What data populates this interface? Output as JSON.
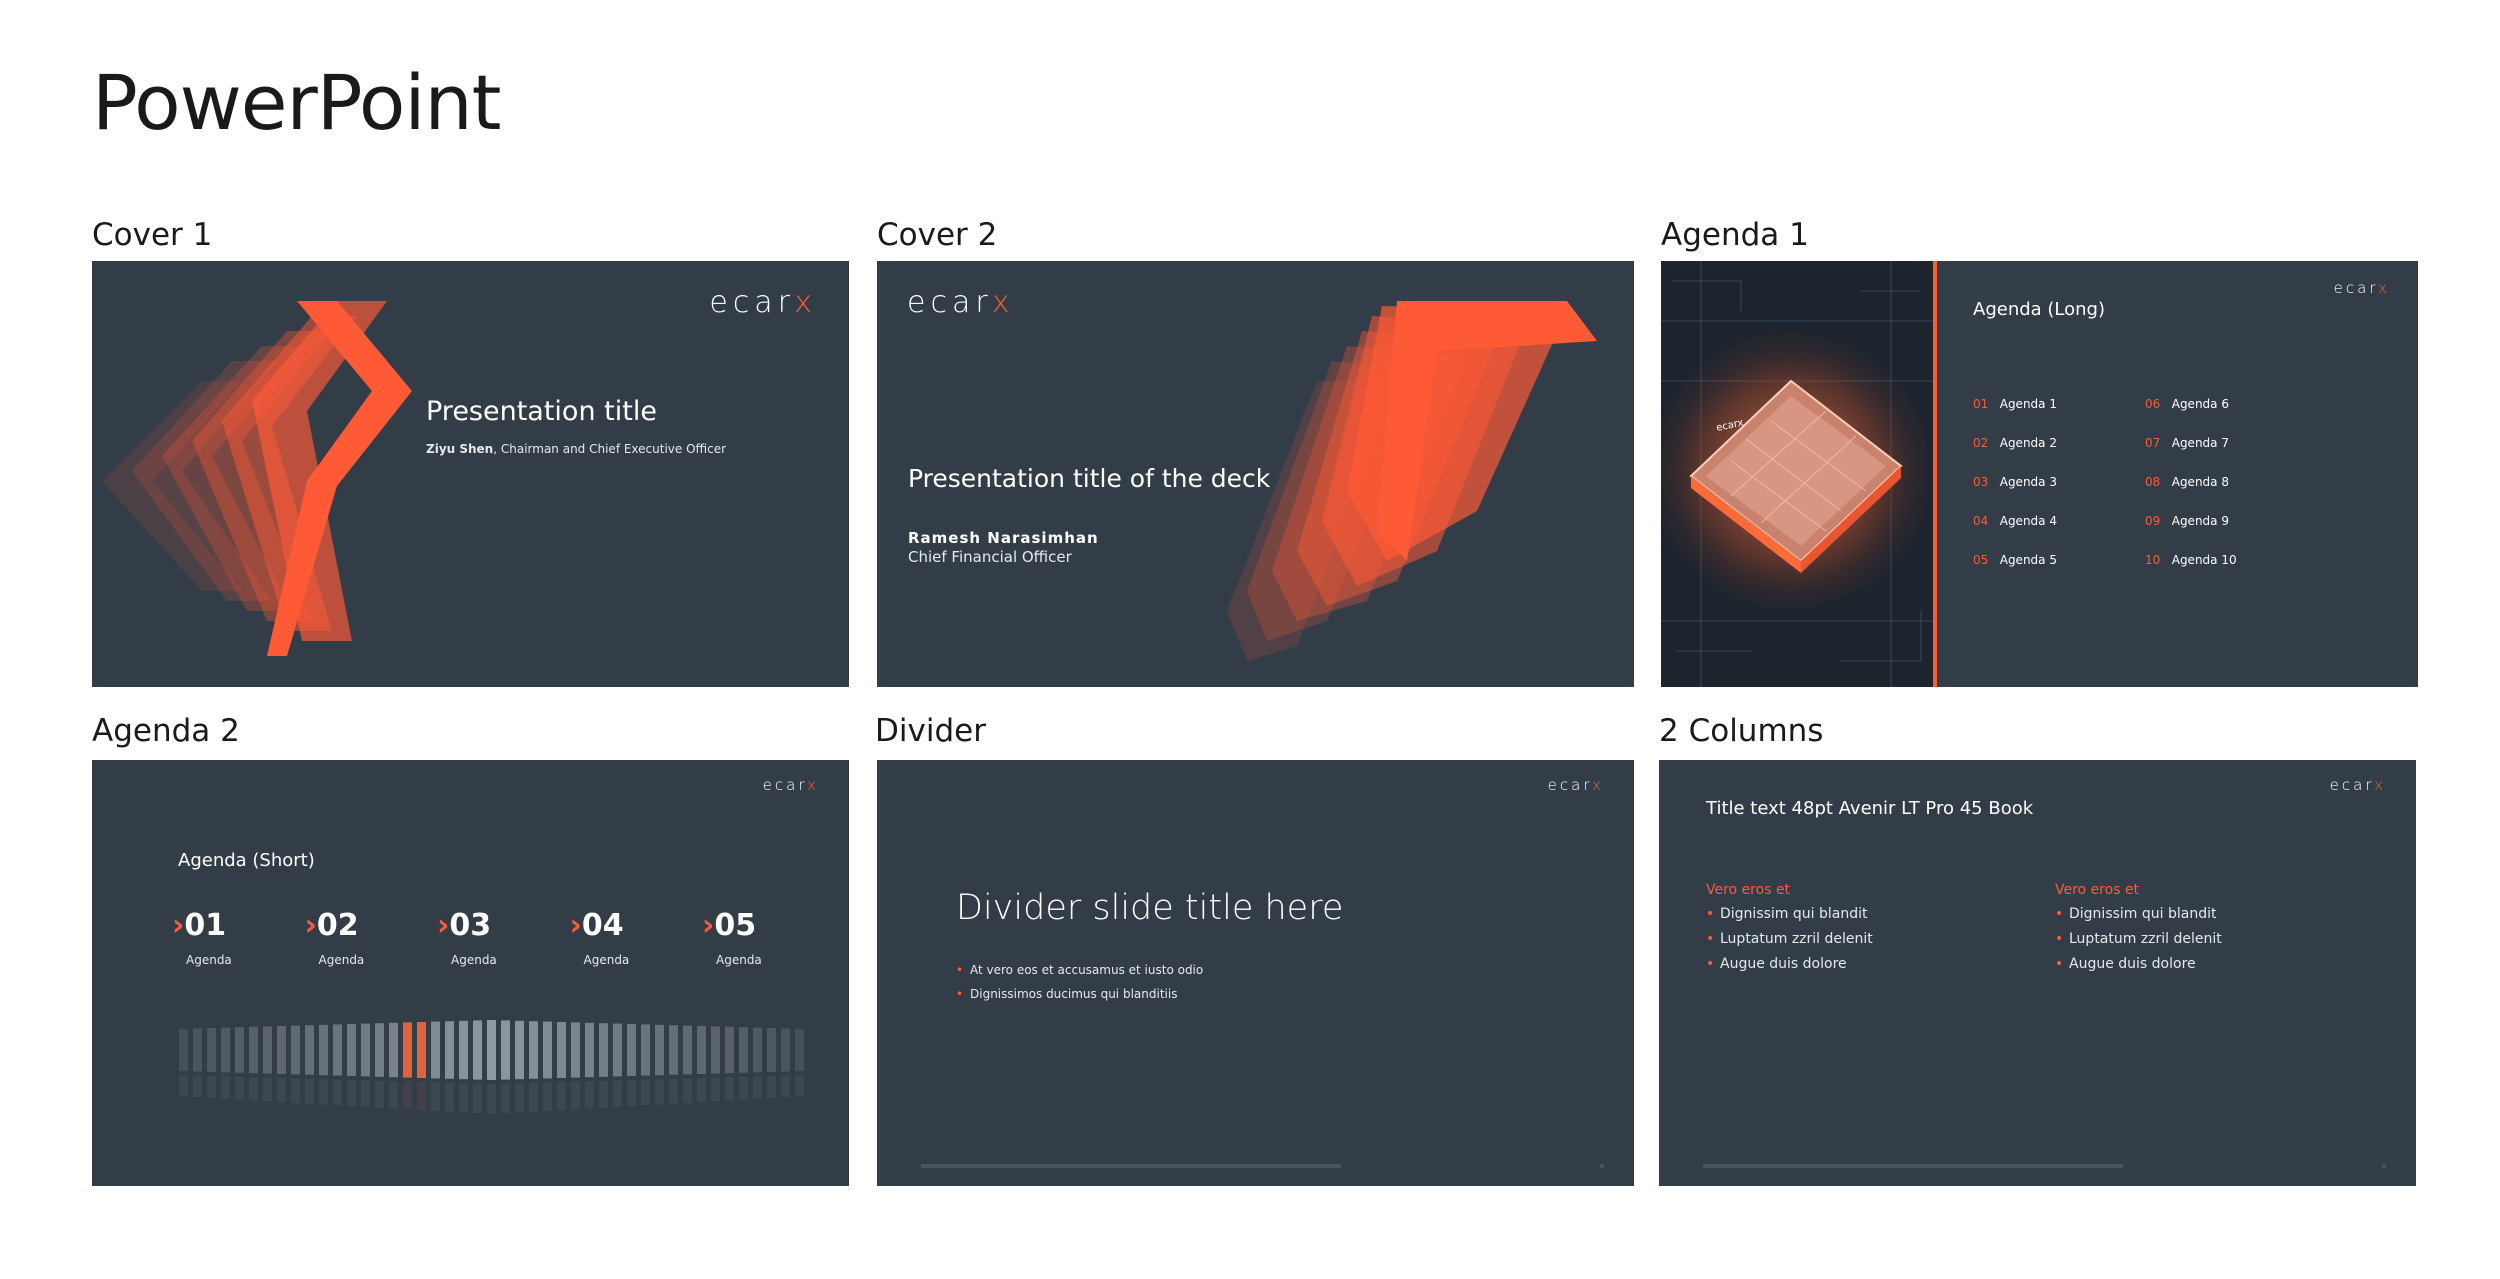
{
  "page_title": "PowerPoint",
  "brand": {
    "logo_main": "ecar",
    "logo_accent": "x",
    "accent_color": "#ff5a36",
    "slide_bg": "#333d48"
  },
  "cells": [
    {
      "label": "Cover 1"
    },
    {
      "label": "Cover 2"
    },
    {
      "label": "Agenda 1"
    },
    {
      "label": "Agenda 2"
    },
    {
      "label": "Divider"
    },
    {
      "label": "2 Columns"
    }
  ],
  "cover1": {
    "title": "Presentation title",
    "name": "Ziyu Shen",
    "role": ", Chairman and Chief Executive Officer"
  },
  "cover2": {
    "title": "Presentation title of the deck",
    "name": "Ramesh Narasimhan",
    "role": "Chief Financial Officer"
  },
  "agenda1": {
    "heading": "Agenda (Long)",
    "chip_text": "ecarx",
    "left": [
      {
        "num": "01",
        "label": "Agenda 1"
      },
      {
        "num": "02",
        "label": "Agenda 2"
      },
      {
        "num": "03",
        "label": "Agenda 3"
      },
      {
        "num": "04",
        "label": "Agenda 4"
      },
      {
        "num": "05",
        "label": "Agenda 5"
      }
    ],
    "right": [
      {
        "num": "06",
        "label": "Agenda 6"
      },
      {
        "num": "07",
        "label": "Agenda 7"
      },
      {
        "num": "08",
        "label": "Agenda 8"
      },
      {
        "num": "09",
        "label": "Agenda 9"
      },
      {
        "num": "10",
        "label": "Agenda 10"
      }
    ]
  },
  "agenda2": {
    "heading": "Agenda (Short)",
    "items": [
      {
        "arrow": "›",
        "num": "01",
        "label": "Agenda"
      },
      {
        "arrow": "›",
        "num": "02",
        "label": "Agenda"
      },
      {
        "arrow": "›",
        "num": "03",
        "label": "Agenda"
      },
      {
        "arrow": "›",
        "num": "04",
        "label": "Agenda"
      },
      {
        "arrow": "›",
        "num": "05",
        "label": "Agenda"
      }
    ]
  },
  "divider": {
    "title": "Divider slide title here",
    "bullets": [
      "At vero eos et accusamus et iusto odio",
      "Dignissimos ducimus qui blanditiis"
    ]
  },
  "two_columns": {
    "title": "Title text 48pt Avenir LT Pro 45 Book",
    "col1": {
      "heading": "Vero eros et",
      "bullets": [
        "Dignissim qui blandit",
        "Luptatum zzril delenit",
        "Augue duis dolore"
      ]
    },
    "col2": {
      "heading": "Vero eros et",
      "bullets": [
        "Dignissim qui blandit",
        "Luptatum zzril delenit",
        "Augue duis dolore"
      ]
    }
  }
}
